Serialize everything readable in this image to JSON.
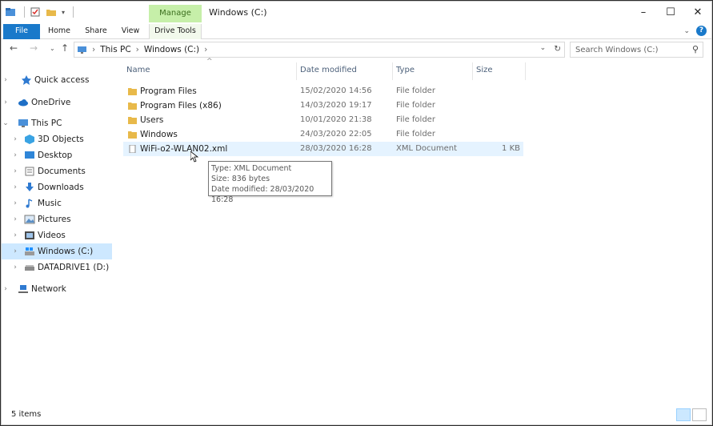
{
  "window": {
    "title": "Windows  (C:)",
    "contextual_tab": "Manage",
    "controls": [
      "–",
      "☐",
      "✕"
    ]
  },
  "ribbon": {
    "tabs": [
      "File",
      "Home",
      "Share",
      "View",
      "Drive Tools"
    ]
  },
  "address": {
    "path": [
      "This PC",
      "Windows  (C:)"
    ],
    "search_placeholder": "Search Windows  (C:)"
  },
  "nav": {
    "items": [
      {
        "label": "Quick access"
      },
      {
        "label": "OneDrive"
      },
      {
        "label": "This PC"
      },
      {
        "label": "3D Objects"
      },
      {
        "label": "Desktop"
      },
      {
        "label": "Documents"
      },
      {
        "label": "Downloads"
      },
      {
        "label": "Music"
      },
      {
        "label": "Pictures"
      },
      {
        "label": "Videos"
      },
      {
        "label": "Windows  (C:)"
      },
      {
        "label": "DATADRIVE1 (D:)"
      },
      {
        "label": "Network"
      }
    ]
  },
  "columns": {
    "name": "Name",
    "date": "Date modified",
    "type": "Type",
    "size": "Size"
  },
  "files": [
    {
      "name": "Program Files",
      "date": "15/02/2020 14:56",
      "type": "File folder",
      "size": ""
    },
    {
      "name": "Program Files (x86)",
      "date": "14/03/2020 19:17",
      "type": "File folder",
      "size": ""
    },
    {
      "name": "Users",
      "date": "10/01/2020 21:38",
      "type": "File folder",
      "size": ""
    },
    {
      "name": "Windows",
      "date": "24/03/2020 22:05",
      "type": "File folder",
      "size": ""
    },
    {
      "name": "WiFi-o2-WLAN02.xml",
      "date": "28/03/2020 16:28",
      "type": "XML Document",
      "size": "1 KB"
    }
  ],
  "tooltip": {
    "line1": "Type: XML Document",
    "line2": "Size: 836 bytes",
    "line3": "Date modified: 28/03/2020 16:28"
  },
  "status": {
    "items_count": "5 items"
  },
  "colors": {
    "accent": "#1979ca",
    "manage_tab": "#c6efa9",
    "selection": "#cde8ff",
    "folder": "#e8b94a"
  }
}
